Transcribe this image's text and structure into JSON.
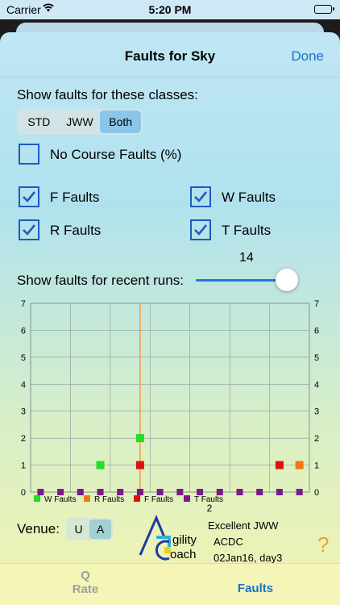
{
  "status_bar": {
    "carrier": "Carrier",
    "time": "5:20 PM"
  },
  "nav": {
    "title": "Faults for Sky",
    "done_label": "Done"
  },
  "classes": {
    "heading": "Show faults for these classes:",
    "segments": [
      "STD",
      "JWW",
      "Both"
    ],
    "selected": "Both"
  },
  "no_course_faults": {
    "label": "No Course Faults (%)",
    "checked": false
  },
  "fault_types": [
    {
      "label": "F Faults",
      "checked": true
    },
    {
      "label": "W Faults",
      "checked": true
    },
    {
      "label": "R Faults",
      "checked": true
    },
    {
      "label": "T Faults",
      "checked": true
    }
  ],
  "recent_runs": {
    "label": "Show faults for recent runs:",
    "value": "14",
    "slider_fraction": 1.0
  },
  "chart_data": {
    "type": "scatter",
    "ylim": [
      0,
      7
    ],
    "yticks": [
      "0",
      "1",
      "2",
      "3",
      "4",
      "5",
      "6",
      "7"
    ],
    "run_count": 14,
    "selected_run": 6,
    "selected_label": "2",
    "series": [
      {
        "name": "W Faults",
        "color": "#22dd22",
        "points": [
          [
            4,
            1
          ],
          [
            6,
            2
          ]
        ]
      },
      {
        "name": "R Faults",
        "color": "#ee7a12",
        "points": [
          [
            14,
            1
          ]
        ]
      },
      {
        "name": "F Faults",
        "color": "#dd1111",
        "points": [
          [
            6,
            1
          ],
          [
            13,
            1
          ]
        ]
      },
      {
        "name": "T Faults",
        "color": "#7a1a8a",
        "points": [
          [
            1,
            0
          ],
          [
            2,
            0
          ],
          [
            3,
            0
          ],
          [
            4,
            0
          ],
          [
            5,
            0
          ],
          [
            6,
            0
          ],
          [
            7,
            0
          ],
          [
            8,
            0
          ],
          [
            9,
            0
          ],
          [
            10,
            0
          ],
          [
            11,
            0
          ],
          [
            12,
            0
          ],
          [
            13,
            0
          ],
          [
            14,
            0
          ]
        ]
      }
    ]
  },
  "venue": {
    "label": "Venue:",
    "options": [
      "U",
      "A"
    ],
    "selected": "A"
  },
  "run_info": {
    "class": "Excellent JWW",
    "club": "ACDC",
    "date": "02Jan16, day3"
  },
  "logo": {
    "text": "Agility Coach"
  },
  "help_label": "?",
  "tabs": [
    {
      "icon": "Q",
      "label": "Rate",
      "active": false
    },
    {
      "label": "Faults",
      "active": true
    }
  ],
  "colors": {
    "accent": "#1a73c9",
    "checkbox": "#1e5ac0",
    "tab_inactive": "#9aa0a0"
  }
}
